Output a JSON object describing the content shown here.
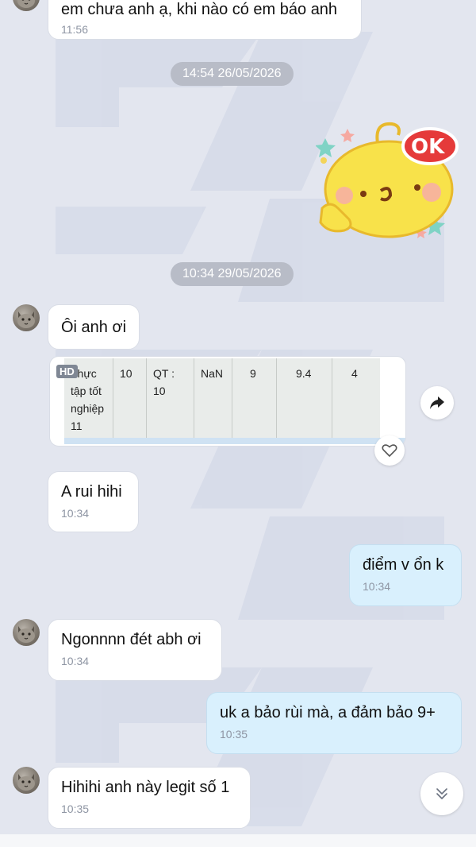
{
  "dates": [
    "14:54 26/05/2026",
    "10:34 29/05/2026"
  ],
  "top_partial": {
    "text": "em chưa anh ạ, khi nào có em báo anh",
    "time": "11:56"
  },
  "sticker": {
    "label": "OK"
  },
  "messages": [
    {
      "text": "Ôi anh ơi",
      "time": ""
    },
    {
      "text": "A rui hihi",
      "time": "10:34"
    },
    {
      "text": "điểm v ổn k",
      "time": "10:34"
    },
    {
      "text": "Ngonnnn đét abh ơi",
      "time": "10:34"
    },
    {
      "text": "uk a bảo rùi mà, a đảm bảo 9+",
      "time": "10:35"
    },
    {
      "text": "Hihihi anh này legit số 1",
      "time": "10:35"
    }
  ],
  "image_badge": "HD",
  "table": {
    "cells": [
      "Thực tập tốt nghiệp 11",
      "10",
      "QT : 10",
      "NaN",
      "9",
      "9.4",
      "4"
    ]
  },
  "icons": {
    "forward": "share-arrow-icon",
    "react": "heart-icon",
    "scroll_down": "double-chevron-down-icon"
  },
  "colors": {
    "background": "#e3e6ef",
    "incoming_bubble": "#ffffff",
    "outgoing_bubble": "#d9f0fd",
    "date_pill": "#b8bcc7"
  }
}
